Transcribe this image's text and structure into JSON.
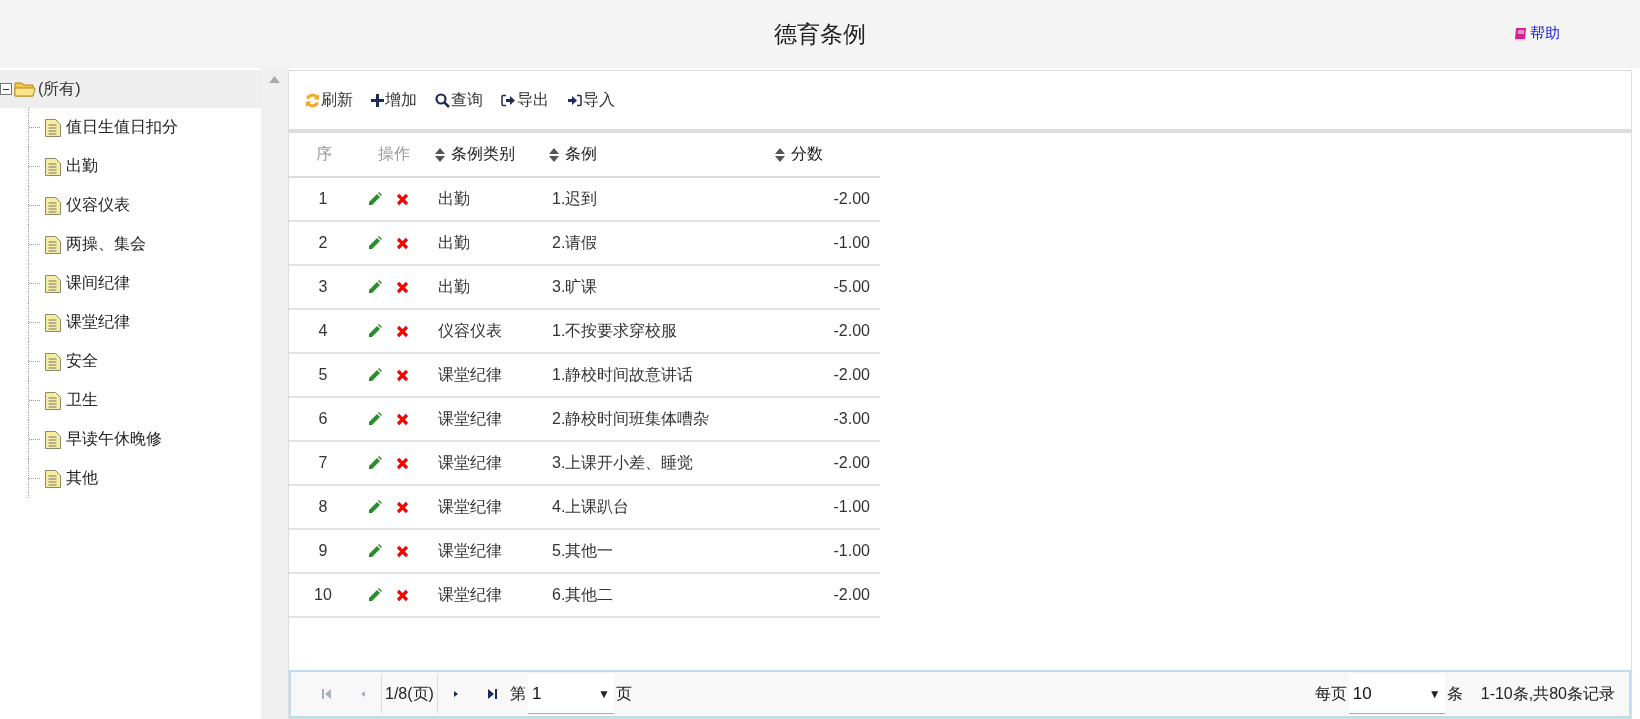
{
  "header": {
    "title": "德育条例",
    "help": "帮助"
  },
  "tree": {
    "label": "(所有)",
    "expanded": true,
    "selected": true,
    "children": [
      {
        "label": "值日生值日扣分"
      },
      {
        "label": "出勤"
      },
      {
        "label": "仪容仪表"
      },
      {
        "label": "两操、集会"
      },
      {
        "label": "课间纪律"
      },
      {
        "label": "课堂纪律"
      },
      {
        "label": "安全"
      },
      {
        "label": "卫生"
      },
      {
        "label": "早读午休晚修"
      },
      {
        "label": "其他"
      }
    ]
  },
  "toolbar": [
    {
      "kind": "refresh",
      "label": "刷新"
    },
    {
      "kind": "add",
      "label": "增加"
    },
    {
      "kind": "search",
      "label": "查询"
    },
    {
      "kind": "export",
      "label": "导出"
    },
    {
      "kind": "import",
      "label": "导入"
    }
  ],
  "table": {
    "columns": [
      {
        "label": "序",
        "sortable": false
      },
      {
        "label": "操作",
        "sortable": false
      },
      {
        "label": "条例类别",
        "sortable": true
      },
      {
        "label": "条例",
        "sortable": true
      },
      {
        "label": "分数",
        "sortable": true
      }
    ],
    "rows": [
      [
        "1",
        "",
        "出勤",
        "1.迟到",
        "-2.00"
      ],
      [
        "2",
        "",
        "出勤",
        "2.请假",
        "-1.00"
      ],
      [
        "3",
        "",
        "出勤",
        "3.旷课",
        "-5.00"
      ],
      [
        "4",
        "",
        "仪容仪表",
        "1.不按要求穿校服",
        "-2.00"
      ],
      [
        "5",
        "",
        "课堂纪律",
        "1.静校时间故意讲话",
        "-2.00"
      ],
      [
        "6",
        "",
        "课堂纪律",
        "2.静校时间班集体嘈杂",
        "-3.00"
      ],
      [
        "7",
        "",
        "课堂纪律",
        "3.上课开小差、睡觉",
        "-2.00"
      ],
      [
        "8",
        "",
        "课堂纪律",
        "4.上课趴台",
        "-1.00"
      ],
      [
        "9",
        "",
        "课堂纪律",
        "5.其他一",
        "-1.00"
      ],
      [
        "10",
        "",
        "课堂纪律",
        "6.其他二",
        "-2.00"
      ]
    ]
  },
  "pager": {
    "first_disabled": true,
    "prev_disabled": true,
    "next_disabled": false,
    "last_disabled": false,
    "page_info": "1/8(页)",
    "page_prefix": "第",
    "page_value": "1",
    "page_caret": "▼",
    "size_caret": "▼",
    "page_suffix": "页",
    "size_prefix": "每页",
    "size_value": "10",
    "size_suffix": "条",
    "summary": "1-10条,共80条记录"
  }
}
